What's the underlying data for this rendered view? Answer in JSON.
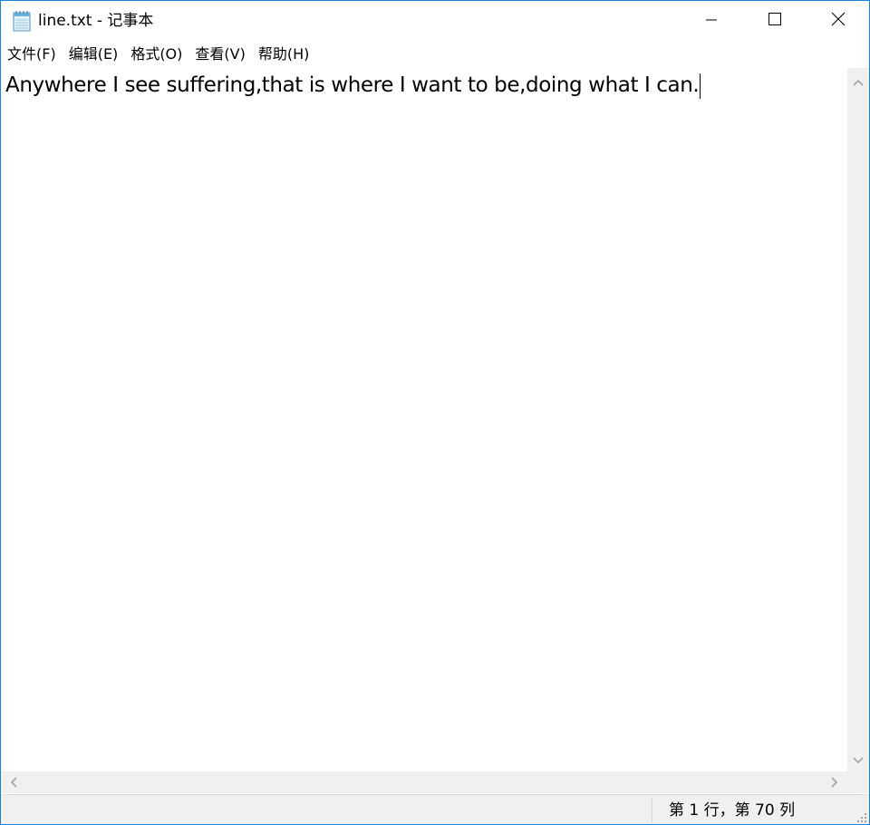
{
  "window": {
    "title": "line.txt - 记事本",
    "border_color": "#1883d7"
  },
  "menu": {
    "items": [
      {
        "label": "文件(F)",
        "icon": ""
      },
      {
        "label": "编辑(E)",
        "icon": ""
      },
      {
        "label": "格式(O)",
        "icon": ""
      },
      {
        "label": "查看(V)",
        "icon": ""
      },
      {
        "label": "帮助(H)",
        "icon": ""
      }
    ]
  },
  "editor": {
    "content": "Anywhere I see suffering,that is where I want to be,doing what I can."
  },
  "status": {
    "position": "第 1 行，第 70 列"
  },
  "icons": {
    "app": "notepad-icon",
    "minimize": "minimize-icon",
    "maximize": "maximize-icon",
    "close": "close-icon"
  }
}
